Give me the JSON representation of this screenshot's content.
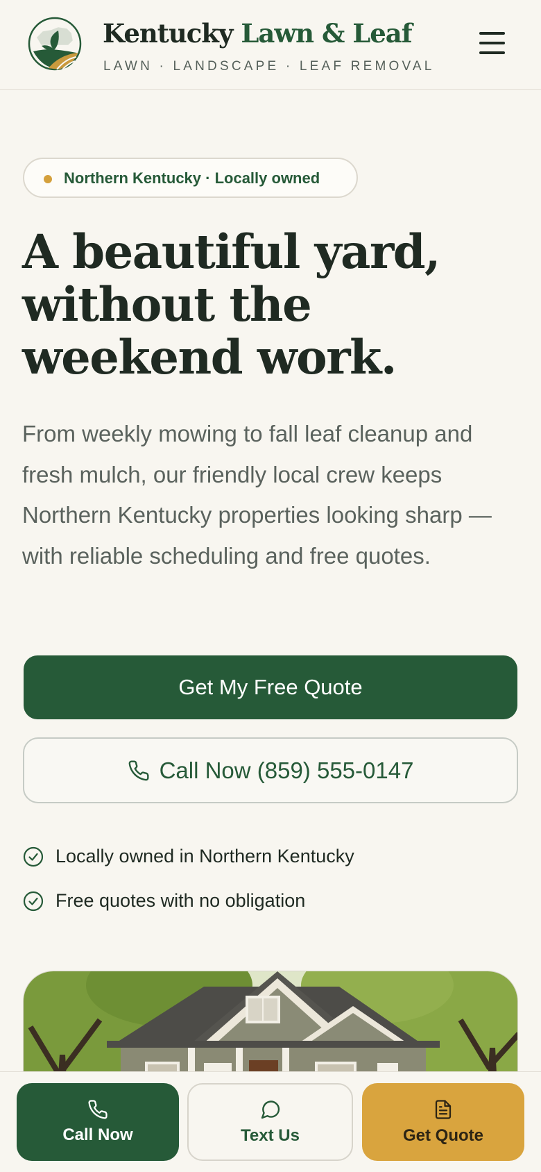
{
  "header": {
    "brand_name_part1": "Kentucky",
    "brand_name_part2": "Lawn & Leaf",
    "tagline": "LAWN · LANDSCAPE · LEAF REMOVAL",
    "menu_icon": "hamburger-menu-icon",
    "logo_icon": "leaf-kentucky-logo"
  },
  "hero": {
    "badge_text": "Northern Kentucky · Locally owned",
    "title_lines": [
      "A beautiful yard,",
      "without the",
      "weekend work."
    ],
    "description": "From weekly mowing to fall leaf cleanup and fresh mulch, our friendly local crew keeps Northern Kentucky properties looking sharp — with reliable scheduling and free quotes.",
    "primary_button": "Get My Free Quote",
    "call_button": "Call Now (859) 555-0147",
    "trust_points": [
      "Locally owned in Northern Kentucky",
      "Free quotes with no obligation"
    ],
    "image_icon": "house-with-lawn-photo"
  },
  "bottom_bar": {
    "call": "Call Now",
    "text": "Text Us",
    "quote": "Get Quote"
  },
  "colors": {
    "background": "#f8f6f0",
    "brand_green": "#265a38",
    "accent_gold": "#d9a43e",
    "text_dark": "#1f2a22",
    "text_muted": "#5a625d"
  }
}
